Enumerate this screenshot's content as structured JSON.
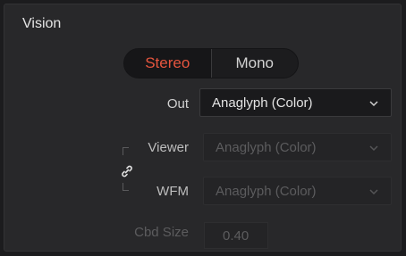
{
  "panel": {
    "title": "Vision"
  },
  "mode_toggle": {
    "options": [
      "Stereo",
      "Mono"
    ],
    "selected": "Stereo"
  },
  "out": {
    "label": "Out",
    "value": "Anaglyph (Color)"
  },
  "viewer": {
    "label": "Viewer",
    "value": "Anaglyph (Color)"
  },
  "wfm": {
    "label": "WFM",
    "value": "Anaglyph (Color)"
  },
  "cbd_size": {
    "label": "Cbd Size",
    "value": "0.40"
  },
  "colors": {
    "accent": "#e6553e",
    "disabled_text": "#5c5c5e",
    "text": "#e4e4e4"
  },
  "icons": [
    "chevron-down-icon",
    "link-icon"
  ]
}
